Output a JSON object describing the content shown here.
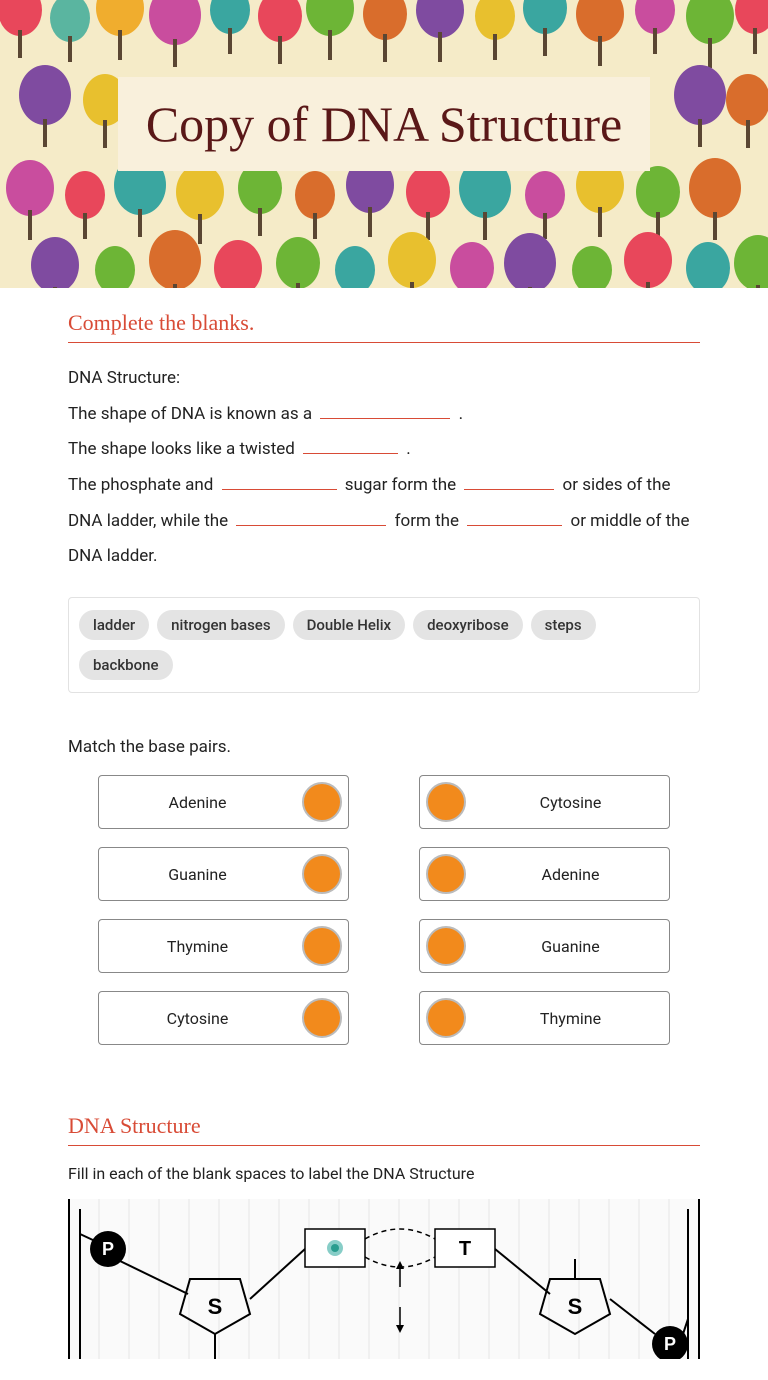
{
  "header": {
    "title": "Copy of DNA Structure"
  },
  "section1": {
    "title": "Complete the blanks.",
    "line0": "DNA Structure:",
    "line1a": "The shape of DNA is known as a ",
    "line1b": " .",
    "line2a": "The shape looks like a twisted ",
    "line2b": " .",
    "line3a": "The phosphate and ",
    "line3b": " sugar form the ",
    "line3c": " or sides of the DNA ladder, while the ",
    "line3d": " form the ",
    "line3e": " or middle of the DNA ladder."
  },
  "wordbank": [
    "ladder",
    "nitrogen bases",
    "Double Helix",
    "deoxyribose",
    "steps",
    "backbone"
  ],
  "match": {
    "title": "Match the base pairs.",
    "left": [
      "Adenine",
      "Guanine",
      "Thymine",
      "Cytosine"
    ],
    "right": [
      "Cytosine",
      "Adenine",
      "Guanine",
      "Thymine"
    ]
  },
  "section2": {
    "title": "DNA Structure",
    "instruction": "Fill in each of the blank spaces to label the DNA Structure",
    "labels": {
      "p": "P",
      "s": "S",
      "t": "T"
    }
  }
}
